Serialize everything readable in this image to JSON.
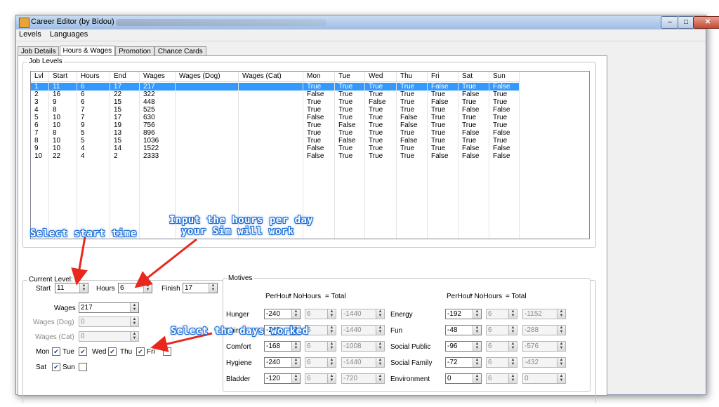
{
  "window": {
    "title": "Career Editor (by Bidou)",
    "controls": {
      "minimize": "–",
      "maximize": "□",
      "close": "✕"
    }
  },
  "menu": [
    "Levels",
    "Languages"
  ],
  "tabs": [
    "Job Details",
    "Hours & Wages",
    "Promotion",
    "Chance Cards"
  ],
  "active_tab": "Hours & Wages",
  "job_levels": {
    "legend": "Job Levels",
    "columns": [
      "Lvl",
      "Start",
      "Hours",
      "End",
      "Wages",
      "Wages (Dog)",
      "Wages (Cat)",
      "Mon",
      "Tue",
      "Wed",
      "Thu",
      "Fri",
      "Sat",
      "Sun"
    ],
    "rows": [
      [
        "1",
        "11",
        "6",
        "17",
        "217",
        "",
        "",
        "True",
        "True",
        "True",
        "True",
        "False",
        "True",
        "False"
      ],
      [
        "2",
        "16",
        "6",
        "22",
        "322",
        "",
        "",
        "False",
        "True",
        "True",
        "True",
        "True",
        "False",
        "True"
      ],
      [
        "3",
        "9",
        "6",
        "15",
        "448",
        "",
        "",
        "True",
        "True",
        "False",
        "True",
        "False",
        "True",
        "True"
      ],
      [
        "4",
        "8",
        "7",
        "15",
        "525",
        "",
        "",
        "True",
        "True",
        "True",
        "True",
        "True",
        "False",
        "False"
      ],
      [
        "5",
        "10",
        "7",
        "17",
        "630",
        "",
        "",
        "False",
        "True",
        "True",
        "False",
        "True",
        "True",
        "True"
      ],
      [
        "6",
        "10",
        "9",
        "19",
        "756",
        "",
        "",
        "True",
        "False",
        "True",
        "False",
        "True",
        "True",
        "True"
      ],
      [
        "7",
        "8",
        "5",
        "13",
        "896",
        "",
        "",
        "True",
        "True",
        "True",
        "True",
        "True",
        "False",
        "False"
      ],
      [
        "8",
        "10",
        "5",
        "15",
        "1036",
        "",
        "",
        "True",
        "False",
        "True",
        "False",
        "True",
        "True",
        "True"
      ],
      [
        "9",
        "10",
        "4",
        "14",
        "1522",
        "",
        "",
        "False",
        "True",
        "True",
        "True",
        "True",
        "False",
        "False"
      ],
      [
        "10",
        "22",
        "4",
        "2",
        "2333",
        "",
        "",
        "False",
        "True",
        "True",
        "True",
        "False",
        "False",
        "False"
      ]
    ],
    "selected_row": 0
  },
  "annotations": {
    "select_start": "Select start time",
    "input_hours_1": "Input the hours per day",
    "input_hours_2": "your Sim will work",
    "select_days": "Select the days worked"
  },
  "current_level": {
    "legend": "Current Level: 1",
    "start_label": "Start",
    "start": "11",
    "hours_label": "Hours",
    "hours": "6",
    "finish_label": "Finish",
    "finish": "17",
    "wages_label": "Wages",
    "wages": "217",
    "wages_dog_label": "Wages (Dog)",
    "wages_dog": "0",
    "wages_cat_label": "Wages (Cat)",
    "wages_cat": "0",
    "days": [
      {
        "label": "Mon",
        "checked": true
      },
      {
        "label": "Tue",
        "checked": true
      },
      {
        "label": "Wed",
        "checked": true
      },
      {
        "label": "Thu",
        "checked": true
      },
      {
        "label": "Fri",
        "checked": false
      },
      {
        "label": "Sat",
        "checked": true
      },
      {
        "label": "Sun",
        "checked": false
      }
    ]
  },
  "motives": {
    "legend": "Motives",
    "headers": [
      "PerHour",
      "* NoHours",
      "= Total"
    ],
    "left": [
      {
        "name": "Hunger",
        "per_hour": "-240",
        "no_hours": "6",
        "total": "-1440"
      },
      {
        "name": "Thirst",
        "per_hour": "-240",
        "no_hours": "6",
        "total": "-1440"
      },
      {
        "name": "Comfort",
        "per_hour": "-168",
        "no_hours": "6",
        "total": "-1008"
      },
      {
        "name": "Hygiene",
        "per_hour": "-240",
        "no_hours": "6",
        "total": "-1440"
      },
      {
        "name": "Bladder",
        "per_hour": "-120",
        "no_hours": "6",
        "total": "-720"
      }
    ],
    "right": [
      {
        "name": "Energy",
        "per_hour": "-192",
        "no_hours": "6",
        "total": "-1152"
      },
      {
        "name": "Fun",
        "per_hour": "-48",
        "no_hours": "6",
        "total": "-288"
      },
      {
        "name": "Social Public",
        "per_hour": "-96",
        "no_hours": "6",
        "total": "-576"
      },
      {
        "name": "Social Family",
        "per_hour": "-72",
        "no_hours": "6",
        "total": "-432"
      },
      {
        "name": "Environment",
        "per_hour": "0",
        "no_hours": "6",
        "total": "0"
      }
    ]
  },
  "colors": {
    "selection": "#3399ff",
    "annotation": "#1f6fd6",
    "arrow": "#e8281e"
  }
}
